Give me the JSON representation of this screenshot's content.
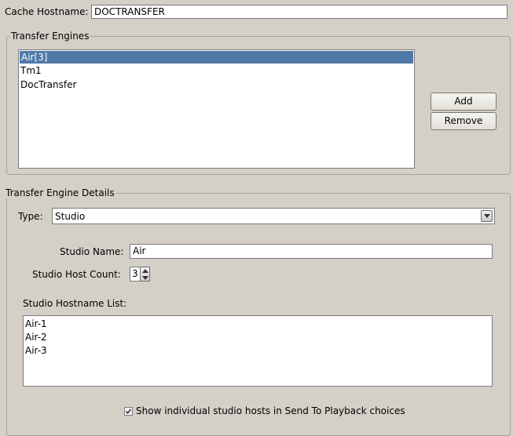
{
  "cache": {
    "label": "Cache Hostname:",
    "value": "DOCTRANSFER"
  },
  "engines": {
    "legend": "Transfer Engines",
    "items": [
      {
        "label": "Air[3]",
        "selected": true
      },
      {
        "label": "Tm1",
        "selected": false
      },
      {
        "label": "DocTransfer",
        "selected": false
      }
    ],
    "add_label": "Add",
    "remove_label": "Remove"
  },
  "details": {
    "legend": "Transfer Engine Details",
    "type_label": "Type:",
    "type_value": "Studio",
    "studio_name_label": "Studio Name:",
    "studio_name_value": "Air",
    "host_count_label": "Studio Host Count:",
    "host_count_value": "3",
    "hostname_list_label": "Studio Hostname List:",
    "hostnames": [
      "Air-1",
      "Air-2",
      "Air-3"
    ],
    "show_hosts_label": "Show individual studio hosts in Send To Playback choices",
    "show_hosts_checked": true
  },
  "colors": {
    "window_bg": "#d4d0c8",
    "selection_bg": "#4e79a7",
    "selection_text": "#ffffff"
  }
}
